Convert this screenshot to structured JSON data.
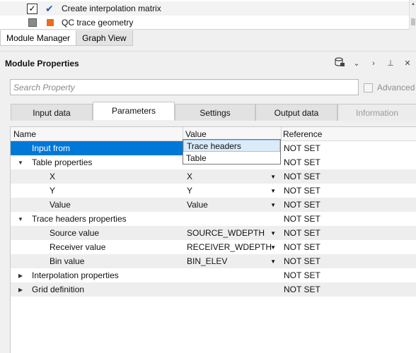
{
  "module_list": {
    "items": [
      {
        "label": "Create interpolation matrix",
        "checked": true,
        "icon": "checkmark-icon"
      },
      {
        "label": "QC trace geometry",
        "checked": false,
        "icon": "orange-square-icon"
      }
    ]
  },
  "bottom_tabs": [
    "Module Manager",
    "Graph View"
  ],
  "panel": {
    "title": "Module Properties",
    "search_placeholder": "Search Property",
    "advanced_label": "Advanced"
  },
  "tabs": [
    "Input data",
    "Parameters",
    "Settings",
    "Output data",
    "Information"
  ],
  "grid": {
    "headers": {
      "name": "Name",
      "value": "Value",
      "reference": "Reference"
    },
    "rows": [
      {
        "name": "Input from",
        "value": "",
        "reference": "NOT SET"
      },
      {
        "name": "Table properties",
        "value": "",
        "reference": "NOT SET"
      },
      {
        "name": "X",
        "value": "X",
        "reference": "NOT SET"
      },
      {
        "name": "Y",
        "value": "Y",
        "reference": "NOT SET"
      },
      {
        "name": "Value",
        "value": "Value",
        "reference": "NOT SET"
      },
      {
        "name": "Trace headers properties",
        "value": "",
        "reference": "NOT SET"
      },
      {
        "name": "Source value",
        "value": "SOURCE_WDEPTH",
        "reference": "NOT SET"
      },
      {
        "name": "Receiver value",
        "value": "RECEIVER_WDEPTH",
        "reference": "NOT SET"
      },
      {
        "name": "Bin value",
        "value": "BIN_ELEV",
        "reference": "NOT SET"
      },
      {
        "name": "Interpolation properties",
        "value": "",
        "reference": "NOT SET"
      },
      {
        "name": "Grid definition",
        "value": "",
        "reference": "NOT SET"
      }
    ]
  },
  "dropdown": {
    "options": [
      "Trace headers",
      "Table"
    ],
    "highlighted": "Trace headers"
  },
  "colors": {
    "selection": "#0078d7",
    "accent_check": "#1f5fb8",
    "orange": "#ef6a1c"
  }
}
